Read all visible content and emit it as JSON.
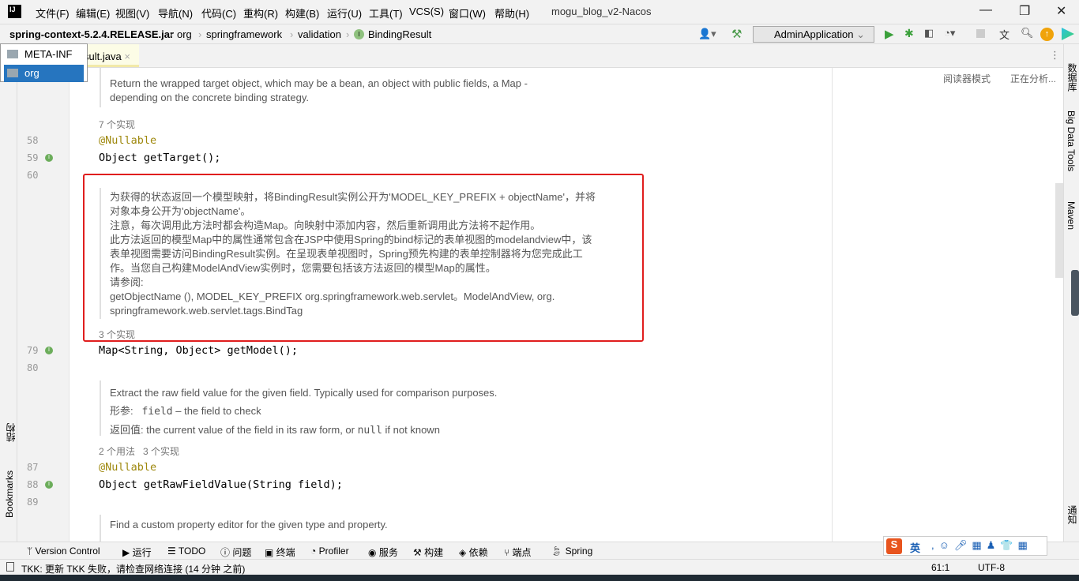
{
  "menu": [
    "文件(F)",
    "编辑(E)",
    "视图(V)",
    "导航(N)",
    "代码(C)",
    "重构(R)",
    "构建(B)",
    "运行(U)",
    "工具(T)",
    "VCS(S)",
    "窗口(W)",
    "帮助(H)"
  ],
  "window_title": "mogu_blog_v2-Nacos",
  "breadcrumb": [
    "spring-context-5.2.4.RELEASE.jar",
    "org",
    "springframework",
    "validation",
    "BindingResult"
  ],
  "run_config": "AdminApplication",
  "tab": "sult.java",
  "popup": [
    "META-INF",
    "org"
  ],
  "reader": {
    "mode": "阅读器模式",
    "analyzing": "正在分析..."
  },
  "editor": {
    "doc1": [
      "Return the wrapped target object, which may be a bean, an object with public fields, a Map -",
      "depending on the concrete binding strategy."
    ],
    "hint1": "7 个实现",
    "l58": "@Nullable",
    "l59": "Object getTarget();",
    "doc2": [
      "为获得的状态返回一个模型映射，将BindingResult实例公开为'MODEL_KEY_PREFIX + objectName'，并将",
      "对象本身公开为'objectName'。",
      "注意，每次调用此方法时都会构造Map。向映射中添加内容，然后重新调用此方法将不起作用。",
      "此方法返回的模型Map中的属性通常包含在JSP中使用Spring的bind标记的表单视图的modelandview中，该",
      "表单视图需要访问BindingResult实例。在呈现表单视图时，Spring预先构建的表单控制器将为您完成此工",
      "作。当您自己构建ModelAndView实例时，您需要包括该方法返回的模型Map的属性。",
      "请参阅:",
      "getObjectName (), MODEL_KEY_PREFIX org.springframework.web.servlet。ModelAndView, org.",
      "springframework.web.servlet.tags.BindTag"
    ],
    "hint2": "3 个实现",
    "l79": "Map<String, Object> getModel();",
    "doc3": {
      "desc": "Extract the raw field value for the given field. Typically used for comparison purposes.",
      "param_label": "形参:",
      "param_name": "field",
      "param_desc": "– the field to check",
      "return_label": "返回值:",
      "return_a": "the current value of the field in its raw form, or",
      "return_null": "null",
      "return_b": "if not known"
    },
    "hint3": "2 个用法   3 个实现",
    "l87": "@Nullable",
    "l88": "Object getRawFieldValue(String field);",
    "doc4": "Find a custom property editor for the given type and property.",
    "line_numbers": [
      "58",
      "59",
      "60",
      "79",
      "80",
      "87",
      "88",
      "89"
    ]
  },
  "left_tools": [
    "结构",
    "Bookmarks"
  ],
  "right_tools": [
    "数据库",
    "Big Data Tools",
    "Maven",
    "通知"
  ],
  "tool_windows": [
    "Version Control",
    "运行",
    "TODO",
    "问题",
    "终端",
    "Profiler",
    "服务",
    "构建",
    "依赖",
    "端点",
    "Spring"
  ],
  "status": {
    "message": "TKK: 更新 TKK 失败，请检查网络连接 (14 分钟 之前)",
    "position": "61:1",
    "encoding": "UTF-8"
  },
  "ime": {
    "lang": "英"
  }
}
